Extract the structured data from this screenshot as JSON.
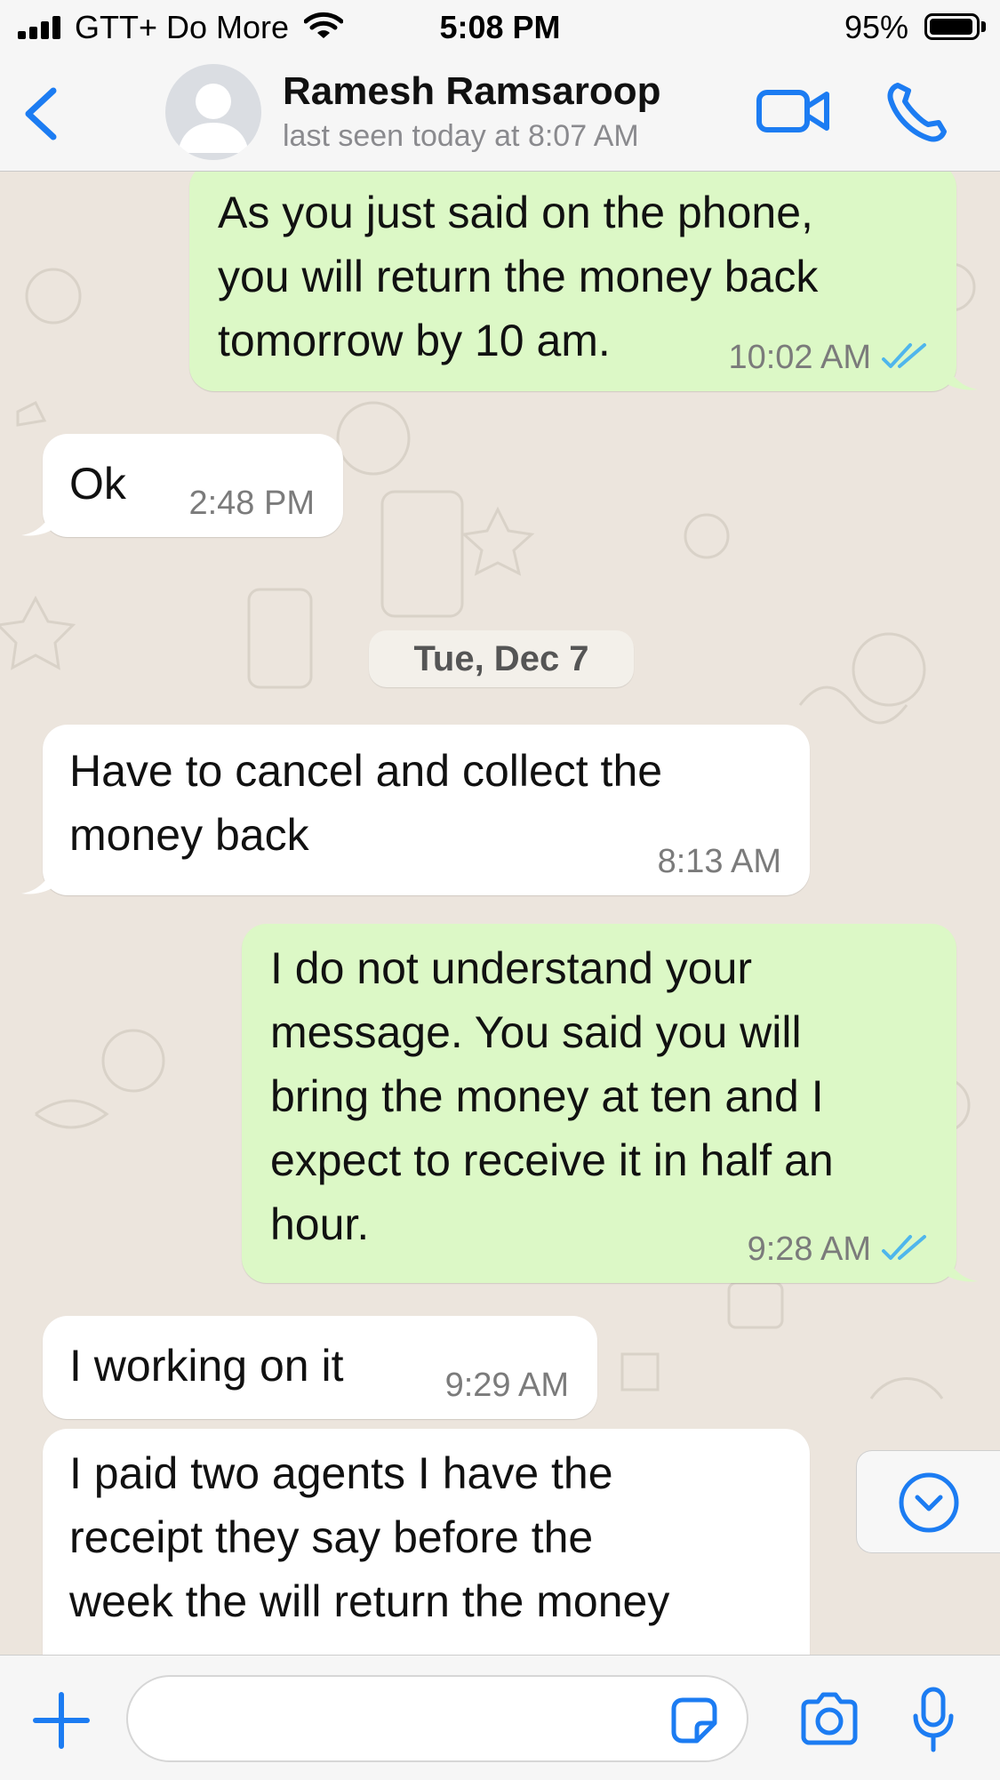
{
  "status_bar": {
    "carrier": "GTT+ Do More",
    "time": "5:08 PM",
    "battery": "95%",
    "icons": [
      "signal-bars-icon",
      "wifi-icon",
      "battery-icon"
    ]
  },
  "header": {
    "contact_name": "Ramesh Ramsaroop",
    "last_seen": "last seen today at 8:07 AM",
    "icons": [
      "back-chevron-icon",
      "avatar-placeholder-icon",
      "video-call-icon",
      "phone-icon"
    ],
    "accent_color": "#1c7cf2"
  },
  "messages": [
    {
      "direction": "outgoing",
      "text": "As you just said on the phone,\nyou will return the money back\ntomorrow by 10 am.",
      "time": "10:02 AM",
      "status": "read"
    },
    {
      "direction": "incoming",
      "text": "Ok",
      "time": "2:48 PM"
    },
    {
      "direction": "incoming",
      "text": "Have to cancel and collect the\nmoney back",
      "time": "8:13 AM"
    },
    {
      "direction": "outgoing",
      "text": "I do not understand your\nmessage. You said you will\nbring the money at ten and I\nexpect to receive it in half an\nhour.",
      "time": "9:28 AM",
      "status": "read"
    },
    {
      "direction": "incoming",
      "text": "I working on it",
      "time": "9:29 AM"
    },
    {
      "direction": "incoming",
      "text": "I paid two agents I have the\nreceipt they say before the\nweek the will return the money",
      "time": ""
    }
  ],
  "date_separator": "Tue, Dec 7",
  "composer": {
    "placeholder": "",
    "icons": [
      "plus-icon",
      "sticker-icon",
      "camera-icon",
      "microphone-icon"
    ]
  },
  "colors": {
    "outgoing_bubble": "#dcf8c6",
    "incoming_bubble": "#ffffff",
    "chat_background": "#ece5dd",
    "read_ticks": "#4fb6ec"
  }
}
